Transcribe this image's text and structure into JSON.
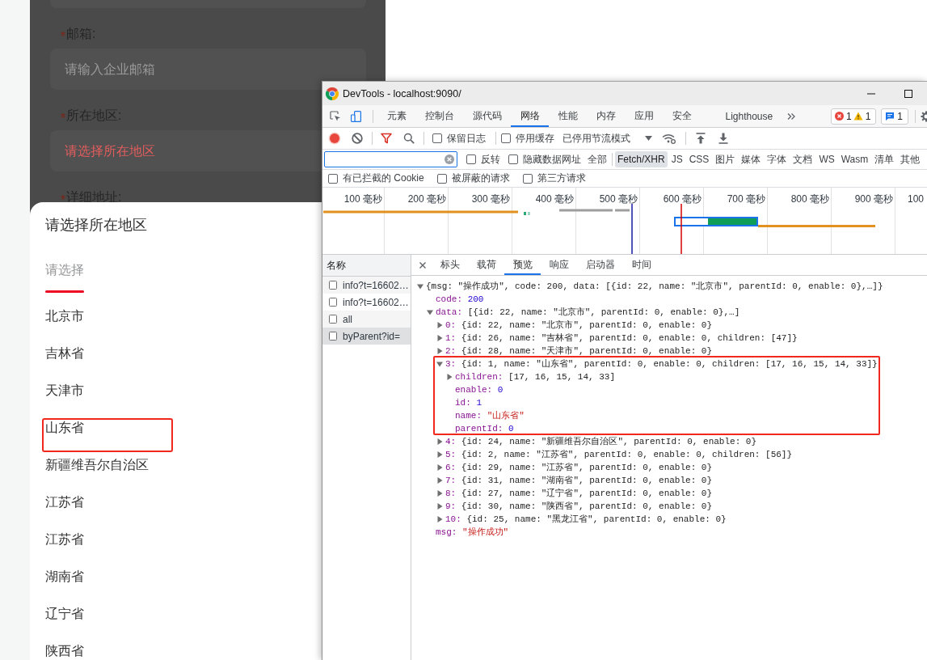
{
  "form": {
    "fields": [
      {
        "label": "邮箱:",
        "required": true,
        "placeholder": "请输入企业邮箱",
        "error": false
      },
      {
        "label": "所在地区:",
        "required": true,
        "placeholder": "请选择所在地区",
        "error": true
      },
      {
        "label": "详细地址:",
        "required": true
      }
    ]
  },
  "region_picker": {
    "title": "请选择所在地区",
    "tabs": [
      {
        "label": "请选择",
        "selected": true
      }
    ],
    "options": [
      {
        "name": "北京市",
        "highlighted": false
      },
      {
        "name": "吉林省",
        "highlighted": false
      },
      {
        "name": "天津市",
        "highlighted": false
      },
      {
        "name": "山东省",
        "highlighted": true
      },
      {
        "name": "新疆维吾尔自治区",
        "highlighted": false
      },
      {
        "name": "江苏省",
        "highlighted": false
      },
      {
        "name": "江苏省",
        "highlighted": false
      },
      {
        "name": "湖南省",
        "highlighted": false
      },
      {
        "name": "辽宁省",
        "highlighted": false
      },
      {
        "name": "陕西省",
        "highlighted": false
      }
    ]
  },
  "devtools": {
    "title": "DevTools - localhost:9090/",
    "panels": [
      {
        "label": "元素",
        "selected": false
      },
      {
        "label": "控制台",
        "selected": false
      },
      {
        "label": "源代码",
        "selected": false
      },
      {
        "label": "网络",
        "selected": true
      },
      {
        "label": "性能",
        "selected": false
      },
      {
        "label": "内存",
        "selected": false
      },
      {
        "label": "应用",
        "selected": false
      },
      {
        "label": "安全",
        "selected": false
      },
      {
        "label": "Lighthouse",
        "selected": false
      }
    ],
    "issues": {
      "errors": "1",
      "warnings": "1",
      "messages": "1"
    },
    "network_toolbar": {
      "recording": true,
      "options": [
        {
          "label": "保留日志",
          "checked": false
        },
        {
          "label": "停用缓存",
          "checked": false
        }
      ],
      "throttling": "已停用节流模式"
    },
    "filter": {
      "options": [
        {
          "label": "反转",
          "checked": false
        },
        {
          "label": "隐藏数据网址",
          "checked": false
        }
      ],
      "types": [
        {
          "label": "全部",
          "selected": false
        },
        {
          "label": "Fetch/XHR",
          "selected": true
        },
        {
          "label": "JS",
          "selected": false
        },
        {
          "label": "CSS",
          "selected": false
        },
        {
          "label": "图片",
          "selected": false
        },
        {
          "label": "媒体",
          "selected": false
        },
        {
          "label": "字体",
          "selected": false
        },
        {
          "label": "文档",
          "selected": false
        },
        {
          "label": "WS",
          "selected": false
        },
        {
          "label": "Wasm",
          "selected": false
        },
        {
          "label": "清单",
          "selected": false
        },
        {
          "label": "其他",
          "selected": false
        }
      ],
      "more_options": [
        {
          "label": "有已拦截的 Cookie",
          "checked": false
        },
        {
          "label": "被屏蔽的请求",
          "checked": false
        },
        {
          "label": "第三方请求",
          "checked": false
        }
      ]
    },
    "timeline": {
      "ticks": [
        "100 毫秒",
        "200 毫秒",
        "300 毫秒",
        "400 毫秒",
        "500 毫秒",
        "600 毫秒",
        "700 毫秒",
        "800 毫秒",
        "900 毫秒",
        "100"
      ]
    },
    "requests": {
      "header": "名称",
      "rows": [
        {
          "name": "info?t=16602…",
          "selected": false
        },
        {
          "name": "info?t=16602…",
          "selected": false
        },
        {
          "name": "all",
          "selected": false
        },
        {
          "name": "byParent?id=",
          "selected": true
        }
      ]
    },
    "detail_tabs": [
      {
        "label": "标头",
        "selected": false
      },
      {
        "label": "载荷",
        "selected": false
      },
      {
        "label": "预览",
        "selected": true
      },
      {
        "label": "响应",
        "selected": false
      },
      {
        "label": "启动器",
        "selected": false
      },
      {
        "label": "时间",
        "selected": false
      }
    ],
    "preview": {
      "tree": {
        "kind": "object",
        "expanded": true,
        "value": "{msg: \"操作成功\", code: 200, data: [{id: 22, name: \"北京市\", parentId: 0, enable: 0},…]}",
        "children": [
          {
            "key": "code:",
            "kind": "number",
            "value": "200"
          },
          {
            "key": "data:",
            "kind": "object",
            "expanded": true,
            "value": "[{id: 22, name: \"北京市\", parentId: 0, enable: 0},…]",
            "children": [
              {
                "key": "0:",
                "kind": "object",
                "expanded": false,
                "highlighted": false,
                "value": "{id: 22, name: \"北京市\", parentId: 0, enable: 0}"
              },
              {
                "key": "1:",
                "kind": "object",
                "expanded": false,
                "highlighted": false,
                "value": "{id: 26, name: \"吉林省\", parentId: 0, enable: 0, children: [47]}"
              },
              {
                "key": "2:",
                "kind": "object",
                "expanded": false,
                "highlighted": false,
                "value": "{id: 28, name: \"天津市\", parentId: 0, enable: 0}"
              },
              {
                "key": "3:",
                "kind": "object",
                "expanded": true,
                "highlighted": true,
                "value": "{id: 1, name: \"山东省\", parentId: 0, enable: 0, children: [17, 16, 15, 14, 33]}",
                "children": [
                  {
                    "key": "children:",
                    "kind": "object",
                    "expanded": false,
                    "value": "[17, 16, 15, 14, 33]"
                  },
                  {
                    "key": "enable:",
                    "kind": "number",
                    "value": "0"
                  },
                  {
                    "key": "id:",
                    "kind": "number",
                    "value": "1"
                  },
                  {
                    "key": "name:",
                    "kind": "string",
                    "value": "\"山东省\""
                  },
                  {
                    "key": "parentId:",
                    "kind": "number",
                    "value": "0"
                  }
                ]
              },
              {
                "key": "4:",
                "kind": "object",
                "expanded": false,
                "highlighted": false,
                "value": "{id: 24, name: \"新疆维吾尔自治区\", parentId: 0, enable: 0}"
              },
              {
                "key": "5:",
                "kind": "object",
                "expanded": false,
                "highlighted": false,
                "value": "{id: 2, name: \"江苏省\", parentId: 0, enable: 0, children: [56]}"
              },
              {
                "key": "6:",
                "kind": "object",
                "expanded": false,
                "highlighted": false,
                "value": "{id: 29, name: \"江苏省\", parentId: 0, enable: 0}"
              },
              {
                "key": "7:",
                "kind": "object",
                "expanded": false,
                "highlighted": false,
                "value": "{id: 31, name: \"湖南省\", parentId: 0, enable: 0}"
              },
              {
                "key": "8:",
                "kind": "object",
                "expanded": false,
                "highlighted": false,
                "value": "{id: 27, name: \"辽宁省\", parentId: 0, enable: 0}"
              },
              {
                "key": "9:",
                "kind": "object",
                "expanded": false,
                "highlighted": false,
                "value": "{id: 30, name: \"陕西省\", parentId: 0, enable: 0}"
              },
              {
                "key": "10:",
                "kind": "object",
                "expanded": false,
                "highlighted": false,
                "value": "{id: 25, name: \"黑龙江省\", parentId: 0, enable: 0}"
              }
            ]
          },
          {
            "key": "msg:",
            "kind": "string",
            "value": "\"操作成功\""
          }
        ]
      }
    }
  }
}
